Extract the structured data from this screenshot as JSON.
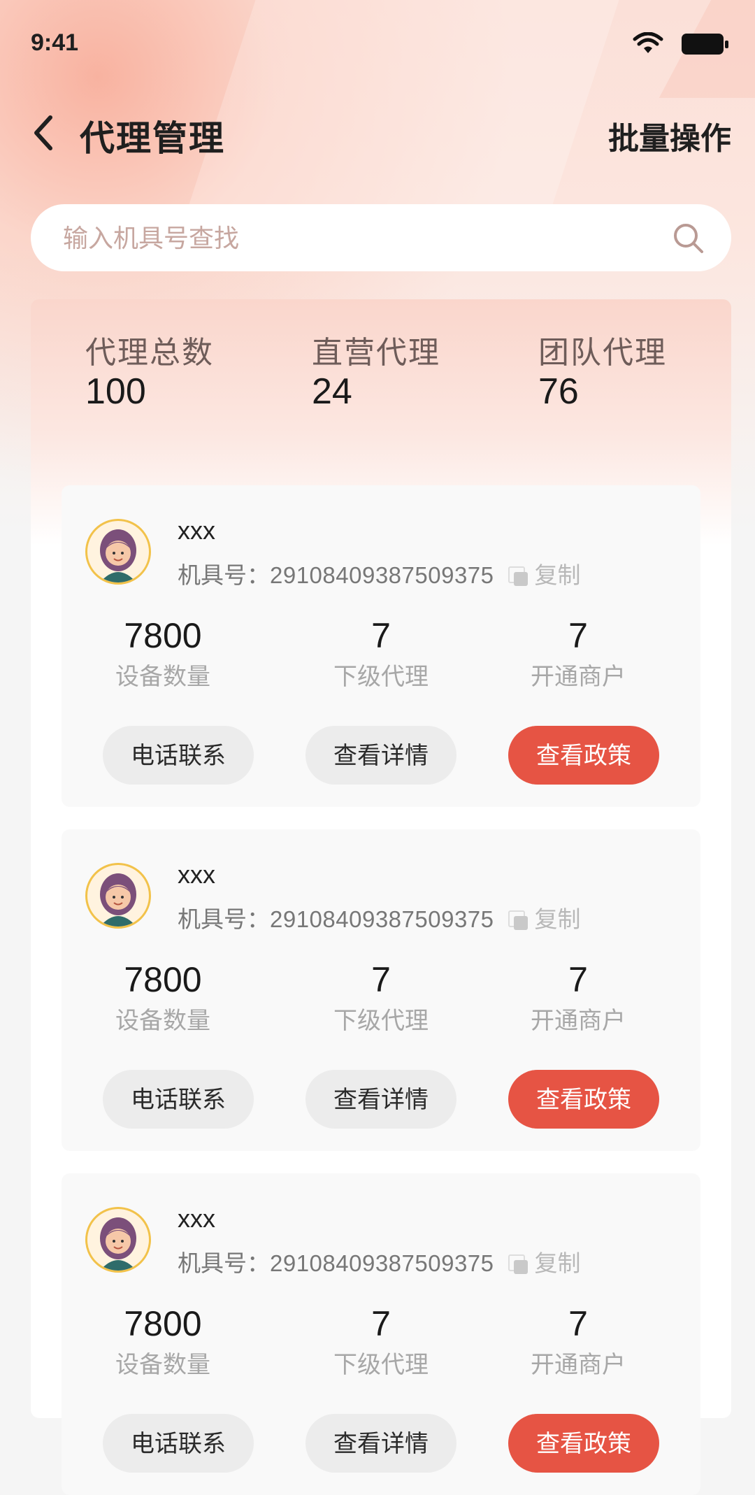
{
  "status_bar": {
    "time": "9:41"
  },
  "header": {
    "title": "代理管理",
    "batch_action": "批量操作"
  },
  "search": {
    "placeholder": "输入机具号查找",
    "value": ""
  },
  "summary": [
    {
      "label": "代理总数",
      "value": "100"
    },
    {
      "label": "直营代理",
      "value": "24"
    },
    {
      "label": "团队代理",
      "value": "76"
    }
  ],
  "agents": [
    {
      "name": "xxx",
      "device_label": "机具号：",
      "device_number": "29108409387509375",
      "copy_label": "复制",
      "metrics": [
        {
          "value": "7800",
          "label": "设备数量"
        },
        {
          "value": "7",
          "label": "下级代理"
        },
        {
          "value": "7",
          "label": "开通商户"
        }
      ],
      "buttons": {
        "call": "电话联系",
        "details": "查看详情",
        "policy": "查看政策"
      }
    },
    {
      "name": "xxx",
      "device_label": "机具号：",
      "device_number": "29108409387509375",
      "copy_label": "复制",
      "metrics": [
        {
          "value": "7800",
          "label": "设备数量"
        },
        {
          "value": "7",
          "label": "下级代理"
        },
        {
          "value": "7",
          "label": "开通商户"
        }
      ],
      "buttons": {
        "call": "电话联系",
        "details": "查看详情",
        "policy": "查看政策"
      }
    },
    {
      "name": "xxx",
      "device_label": "机具号：",
      "device_number": "29108409387509375",
      "copy_label": "复制",
      "metrics": [
        {
          "value": "7800",
          "label": "设备数量"
        },
        {
          "value": "7",
          "label": "下级代理"
        },
        {
          "value": "7",
          "label": "开通商户"
        }
      ],
      "buttons": {
        "call": "电话联系",
        "details": "查看详情",
        "policy": "查看政策"
      }
    }
  ],
  "colors": {
    "accent": "#e65444",
    "avatar_ring": "#f2c24a"
  },
  "icons": [
    "back-icon",
    "search-icon",
    "wifi-icon",
    "battery-icon",
    "copy-icon"
  ]
}
